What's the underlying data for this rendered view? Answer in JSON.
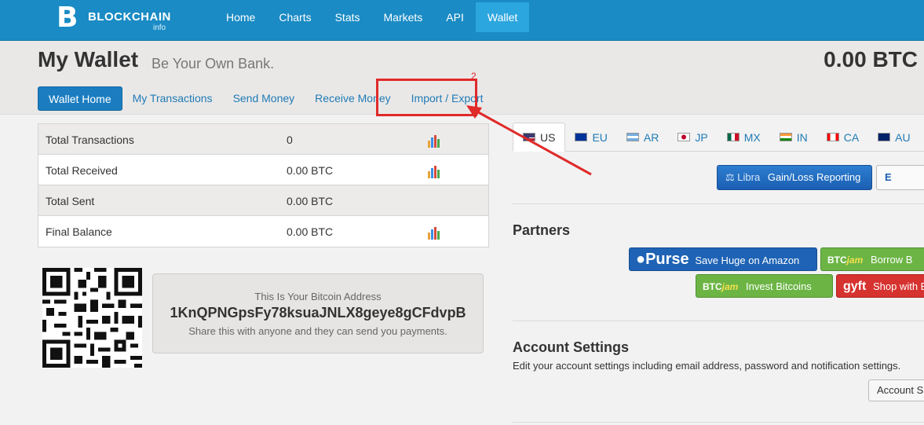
{
  "nav": {
    "logo_text": "BLOCKCHAIN",
    "logo_sub": "info",
    "logo_glyph": "B",
    "items": [
      "Home",
      "Charts",
      "Stats",
      "Markets",
      "API",
      "Wallet"
    ],
    "active": "Wallet"
  },
  "header": {
    "title": "My Wallet",
    "subtitle": "Be Your Own Bank.",
    "balance": "0.00 BTC"
  },
  "subnav": {
    "items": [
      "Wallet Home",
      "My Transactions",
      "Send Money",
      "Receive Money",
      "Import / Export"
    ],
    "active": "Wallet Home"
  },
  "annotation": {
    "number": "2",
    "color": "#e02a2a"
  },
  "stats": [
    {
      "label": "Total Transactions",
      "value": "0",
      "chart": true
    },
    {
      "label": "Total Received",
      "value": "0.00 BTC",
      "chart": true
    },
    {
      "label": "Total Sent",
      "value": "0.00 BTC",
      "chart": false
    },
    {
      "label": "Final Balance",
      "value": "0.00 BTC",
      "chart": true
    }
  ],
  "address": {
    "title": "This Is Your Bitcoin Address",
    "value": "1KnQPNGpsFy78ksuaJNLX8geye8gCFdvpB",
    "help": "Share this with anyone and they can send you payments."
  },
  "currency_tabs": [
    {
      "code": "US",
      "flag": "us-flag-icon",
      "colors": [
        "#b22234",
        "#ffffff",
        "#3c3b6e"
      ]
    },
    {
      "code": "EU",
      "flag": "eu-flag-icon",
      "colors": [
        "#003399",
        "#ffcc00"
      ]
    },
    {
      "code": "AR",
      "flag": "ar-flag-icon",
      "colors": [
        "#74acdf",
        "#ffffff"
      ]
    },
    {
      "code": "JP",
      "flag": "jp-flag-icon",
      "colors": [
        "#ffffff",
        "#bc002d"
      ]
    },
    {
      "code": "MX",
      "flag": "mx-flag-icon",
      "colors": [
        "#006847",
        "#ffffff",
        "#ce1126"
      ]
    },
    {
      "code": "IN",
      "flag": "in-flag-icon",
      "colors": [
        "#ff9933",
        "#ffffff",
        "#138808"
      ]
    },
    {
      "code": "CA",
      "flag": "ca-flag-icon",
      "colors": [
        "#ff0000",
        "#ffffff"
      ]
    },
    {
      "code": "AU",
      "flag": "au-flag-icon",
      "colors": [
        "#012169",
        "#ffffff"
      ]
    }
  ],
  "libra": {
    "brand": "Libra",
    "label": "Gain/Loss Reporting"
  },
  "second_button": {
    "label": "E"
  },
  "partners": {
    "title": "Partners",
    "purse": {
      "brand": "Purse",
      "label": "Save Huge on Amazon"
    },
    "btcjam1": {
      "btc": "BTC",
      "jam": "jam",
      "label": "Borrow B"
    },
    "btcjam2": {
      "btc": "BTC",
      "jam": "jam",
      "label": "Invest Bitcoins"
    },
    "gyft": {
      "brand": "gyft",
      "label": "Shop with B"
    }
  },
  "account": {
    "title": "Account Settings",
    "desc": "Edit your account settings including email address, password and notification settings.",
    "button": "Account S"
  }
}
